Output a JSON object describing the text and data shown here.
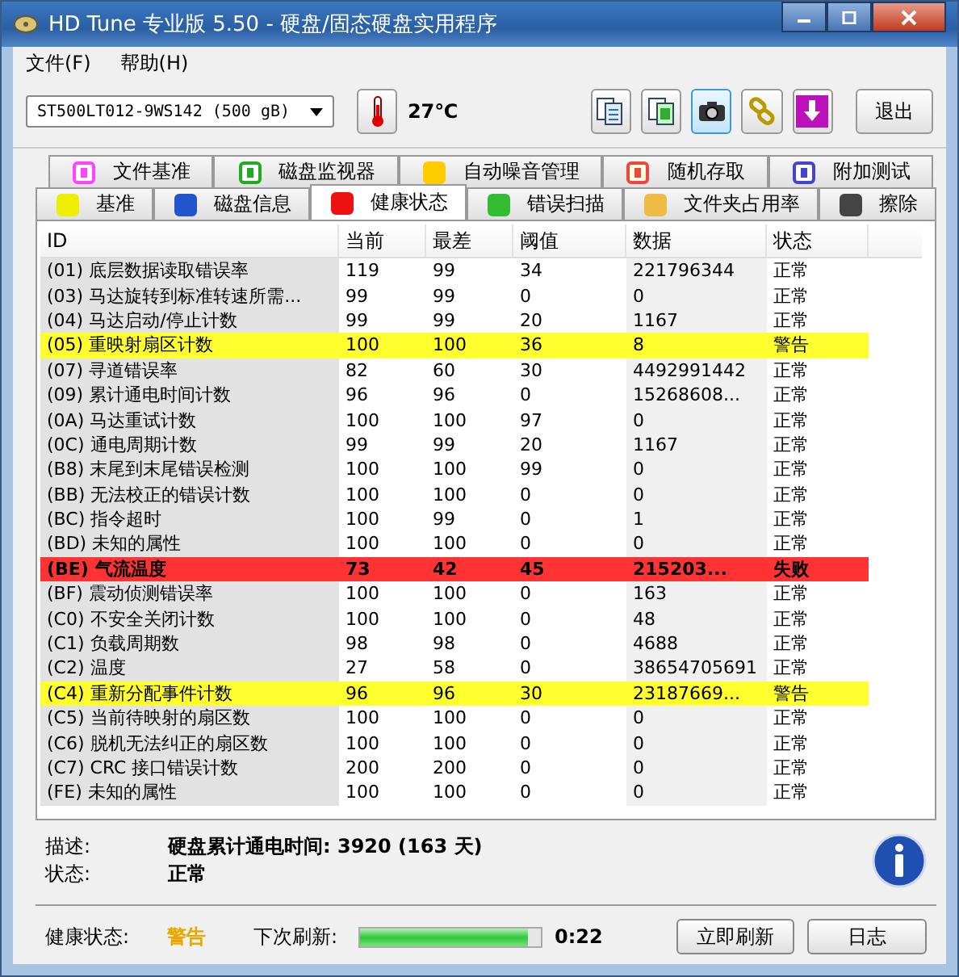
{
  "window": {
    "title": "HD Tune 专业版 5.50 - 硬盘/固态硬盘实用程序"
  },
  "menu": [
    "文件(F)",
    "帮助(H)"
  ],
  "toolbar": {
    "drive": "ST500LT012-9WS142 (500 gB)",
    "temperature": "27℃",
    "tools": [
      {
        "selected": false
      },
      {
        "selected": false
      },
      {
        "selected": true
      },
      {
        "selected": false
      },
      {
        "selected": false
      }
    ],
    "exit": "退出"
  },
  "tab_rows": [
    [
      {
        "label": "文件基准",
        "selected": false
      },
      {
        "label": "磁盘监视器",
        "selected": false
      },
      {
        "label": "自动噪音管理",
        "selected": false
      },
      {
        "label": "随机存取",
        "selected": false
      },
      {
        "label": "附加测试",
        "selected": false
      }
    ],
    [
      {
        "label": "基准",
        "selected": false
      },
      {
        "label": "磁盘信息",
        "selected": false
      },
      {
        "label": "健康状态",
        "selected": true
      },
      {
        "label": "错误扫描",
        "selected": false
      },
      {
        "label": "文件夹占用率",
        "selected": false
      },
      {
        "label": "擦除",
        "selected": false
      }
    ]
  ],
  "table": {
    "columns": [
      "ID",
      "当前",
      "最差",
      "阈值",
      "数据",
      "状态"
    ],
    "rows": [
      {
        "kind": "normal",
        "cells": [
          "(01) 底层数据读取错误率",
          "119",
          "99",
          "34",
          "221796344",
          "正常"
        ]
      },
      {
        "kind": "normal",
        "cells": [
          "(03) 马达旋转到标准转速所需...",
          "99",
          "99",
          "0",
          "0",
          "正常"
        ]
      },
      {
        "kind": "normal",
        "cells": [
          "(04) 马达启动/停止计数",
          "99",
          "99",
          "20",
          "1167",
          "正常"
        ]
      },
      {
        "kind": "warning",
        "cells": [
          "(05) 重映射扇区计数",
          "100",
          "100",
          "36",
          "8",
          "警告"
        ]
      },
      {
        "kind": "normal",
        "cells": [
          "(07) 寻道错误率",
          "82",
          "60",
          "30",
          "4492991442",
          "正常"
        ]
      },
      {
        "kind": "normal",
        "cells": [
          "(09) 累计通电时间计数",
          "96",
          "96",
          "0",
          "15268608...",
          "正常"
        ]
      },
      {
        "kind": "normal",
        "cells": [
          "(0A) 马达重试计数",
          "100",
          "100",
          "97",
          "0",
          "正常"
        ]
      },
      {
        "kind": "normal",
        "cells": [
          "(0C) 通电周期计数",
          "99",
          "99",
          "20",
          "1167",
          "正常"
        ]
      },
      {
        "kind": "normal",
        "cells": [
          "(B8) 末尾到末尾错误检测",
          "100",
          "100",
          "99",
          "0",
          "正常"
        ]
      },
      {
        "kind": "normal",
        "cells": [
          "(BB) 无法校正的错误计数",
          "100",
          "100",
          "0",
          "0",
          "正常"
        ]
      },
      {
        "kind": "normal",
        "cells": [
          "(BC) 指令超时",
          "100",
          "99",
          "0",
          "1",
          "正常"
        ]
      },
      {
        "kind": "normal",
        "cells": [
          "(BD) 未知的属性",
          "100",
          "100",
          "0",
          "0",
          "正常"
        ]
      },
      {
        "kind": "failure",
        "cells": [
          "(BE) 气流温度",
          "73",
          "42",
          "45",
          "215203...",
          "失败"
        ]
      },
      {
        "kind": "normal",
        "cells": [
          "(BF) 震动侦测错误率",
          "100",
          "100",
          "0",
          "163",
          "正常"
        ]
      },
      {
        "kind": "normal",
        "cells": [
          "(C0) 不安全关闭计数",
          "100",
          "100",
          "0",
          "48",
          "正常"
        ]
      },
      {
        "kind": "normal",
        "cells": [
          "(C1) 负载周期数",
          "98",
          "98",
          "0",
          "4688",
          "正常"
        ]
      },
      {
        "kind": "normal",
        "cells": [
          "(C2) 温度",
          "27",
          "58",
          "0",
          "38654705691",
          "正常"
        ]
      },
      {
        "kind": "warning",
        "cells": [
          "(C4) 重新分配事件计数",
          "96",
          "96",
          "30",
          "23187669...",
          "警告"
        ]
      },
      {
        "kind": "normal",
        "cells": [
          "(C5) 当前待映射的扇区数",
          "100",
          "100",
          "0",
          "0",
          "正常"
        ]
      },
      {
        "kind": "normal",
        "cells": [
          "(C6) 脱机无法纠正的扇区数",
          "100",
          "100",
          "0",
          "0",
          "正常"
        ]
      },
      {
        "kind": "normal",
        "cells": [
          "(C7) CRC 接口错误计数",
          "200",
          "200",
          "0",
          "0",
          "正常"
        ]
      },
      {
        "kind": "normal",
        "cells": [
          "(FE) 未知的属性",
          "100",
          "100",
          "0",
          "0",
          "正常"
        ]
      }
    ]
  },
  "details": [
    {
      "label": "描述:",
      "value": "硬盘累计通电时间: 3920 (163 天)"
    },
    {
      "label": "状态:",
      "value": "正常"
    }
  ],
  "status_bar": {
    "health_label": "健康状态:",
    "health": "警告",
    "refresh_label": "下次刷新:",
    "level": 0.93,
    "countdown": "0:22",
    "buttons": [
      "立即刷新",
      "日志"
    ]
  }
}
